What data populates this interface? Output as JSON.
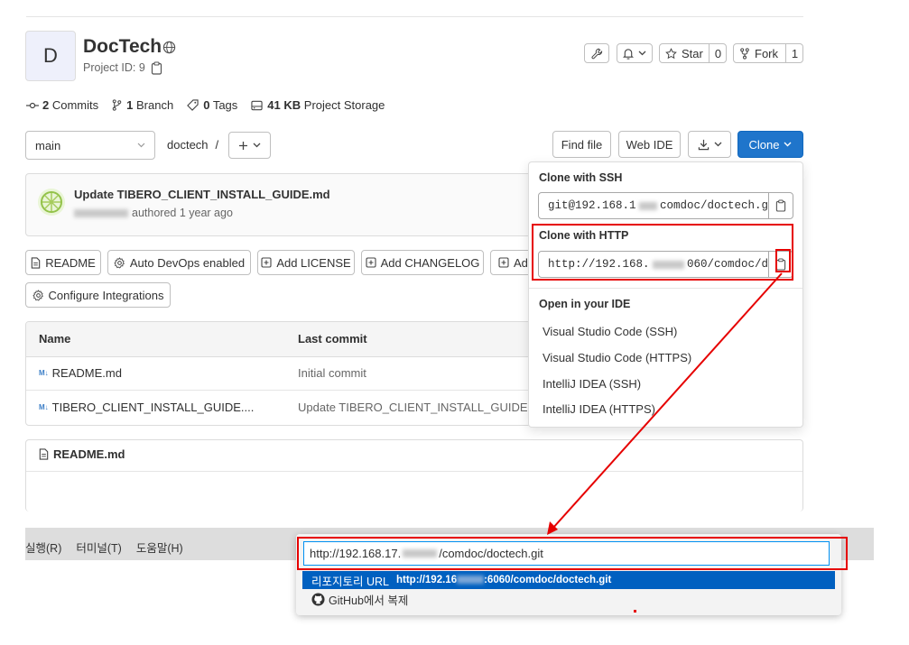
{
  "project": {
    "avatar_letter": "D",
    "name": "DocTech",
    "project_id": "Project ID: 9"
  },
  "header_buttons": {
    "star_label": "Star",
    "star_count": "0",
    "fork_label": "Fork",
    "fork_count": "1"
  },
  "stats": {
    "commits_count": "2",
    "commits_label": "Commits",
    "branch_count": "1",
    "branch_label": "Branch",
    "tags_count": "0",
    "tags_label": "Tags",
    "storage_size": "41 KB",
    "storage_label": "Project Storage"
  },
  "repo_toolbar": {
    "branch": "main",
    "path": "doctech",
    "path_sep": "/",
    "find_file": "Find file",
    "web_ide": "Web IDE",
    "clone": "Clone"
  },
  "last_commit": {
    "message": "Update TIBERO_CLIENT_INSTALL_GUIDE.md",
    "author_suffix": "authored 1 year ago"
  },
  "action_buttons": {
    "readme": "README",
    "auto_devops": "Auto DevOps enabled",
    "add_license": "Add LICENSE",
    "add_changelog": "Add CHANGELOG",
    "add_truncated": "Ad",
    "configure_integrations": "Configure Integrations"
  },
  "file_table": {
    "headers": [
      "Name",
      "Last commit"
    ],
    "rows": [
      {
        "badge": "M↓",
        "name": "README.md",
        "commit": "Initial commit"
      },
      {
        "badge": "M↓",
        "name": "TIBERO_CLIENT_INSTALL_GUIDE....",
        "commit": "Update TIBERO_CLIENT_INSTALL_GUIDE.md"
      }
    ]
  },
  "readme_panel": {
    "title": "README.md"
  },
  "clone_dropdown": {
    "ssh_title": "Clone with SSH",
    "ssh_url_start": "git@192.168.1",
    "ssh_url_end": "comdoc/doctech.g",
    "http_title": "Clone with HTTP",
    "http_url_start": "http://192.168.",
    "http_url_end": "060/comdoc/d",
    "ide_title": "Open in your IDE",
    "ide_options": [
      "Visual Studio Code (SSH)",
      "Visual Studio Code (HTTPS)",
      "IntelliJ IDEA (SSH)",
      "IntelliJ IDEA (HTTPS)"
    ]
  },
  "vscode": {
    "menu": [
      "실행(R)",
      "터미널(T)",
      "도움말(H)"
    ],
    "input_start": "http://192.168.17.",
    "input_end": "/comdoc/doctech.git",
    "suggestion_label": "리포지토리 URL",
    "suggestion_url_start": "http://192.16",
    "suggestion_url_end": ":6060/comdoc/doctech.git",
    "github_clone": "GitHub에서 복제"
  },
  "colors": {
    "accent_blue": "#1f75cb",
    "annotation_red": "#e60000",
    "vscode_selection": "#0060c0"
  },
  "icons": [
    "globe-icon",
    "clipboard-icon",
    "wrench-icon",
    "bell-icon",
    "star-icon",
    "fork-icon",
    "commit-icon",
    "branch-icon",
    "tag-icon",
    "storage-icon",
    "chevron-down-icon",
    "plus-icon",
    "download-icon",
    "file-icon",
    "gear-icon",
    "plus-square-icon",
    "markdown-icon",
    "github-icon"
  ]
}
